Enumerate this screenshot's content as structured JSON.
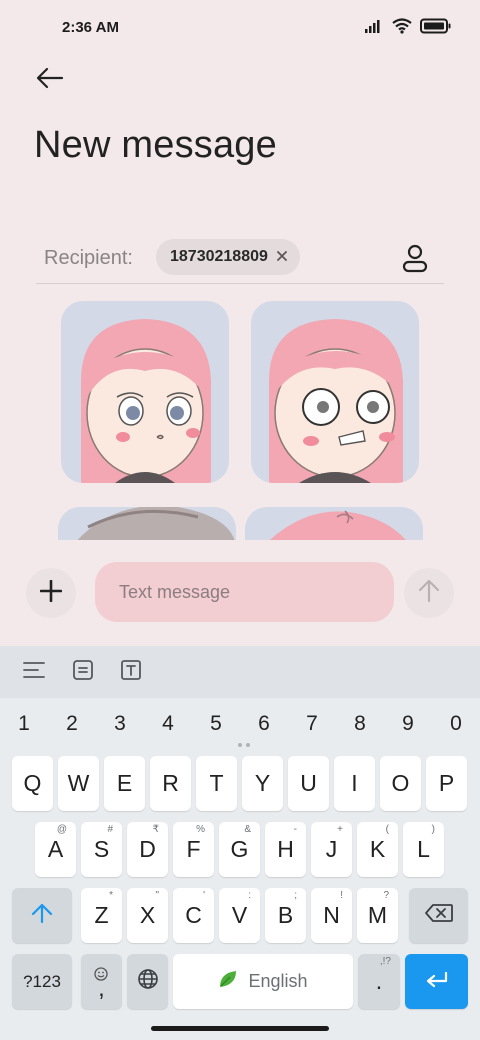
{
  "status": {
    "time": "2:36 AM"
  },
  "header": {
    "title": "New message"
  },
  "recipient": {
    "label": "Recipient:",
    "chip": "18730218809"
  },
  "compose": {
    "placeholder": "Text message"
  },
  "keyboard": {
    "numbers": [
      "1",
      "2",
      "3",
      "4",
      "5",
      "6",
      "7",
      "8",
      "9",
      "0"
    ],
    "row1": [
      "Q",
      "W",
      "E",
      "R",
      "T",
      "Y",
      "U",
      "I",
      "O",
      "P"
    ],
    "row2": [
      "A",
      "S",
      "D",
      "F",
      "G",
      "H",
      "J",
      "K",
      "L"
    ],
    "row2_hints": [
      "@",
      "#",
      "₹",
      "%",
      "&",
      "-",
      "+",
      "(",
      ")"
    ],
    "row3": [
      "Z",
      "X",
      "C",
      "V",
      "B",
      "N",
      "M"
    ],
    "row3_hints": [
      "*",
      "\"",
      "'",
      ":",
      ";",
      "!",
      "?"
    ],
    "symbols_label": "?123",
    "comma_label": ",",
    "space_label": "English",
    "period_label": ".",
    "period_hint": ",!?"
  },
  "colors": {
    "accent": "#1a98f0",
    "compose_field": "#f2cdd1",
    "background": "#f3e9ea"
  },
  "icons": [
    "back-arrow-icon",
    "contact-icon",
    "add-icon",
    "send-arrow-icon",
    "signal-icon",
    "wifi-icon",
    "battery-icon",
    "leaf-icon",
    "globe-icon",
    "emoji-icon",
    "shift-icon",
    "backspace-icon",
    "enter-icon"
  ]
}
